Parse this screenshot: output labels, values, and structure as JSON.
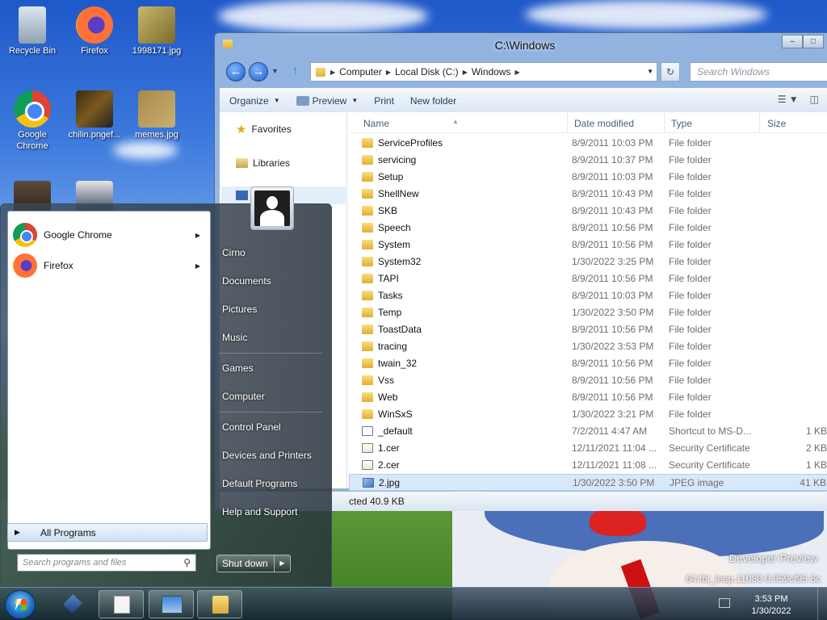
{
  "desktop": {
    "icons": [
      {
        "label": "Recycle Bin"
      },
      {
        "label": "Firefox"
      },
      {
        "label": "1998171.jpg"
      },
      {
        "label": "Google Chrome"
      },
      {
        "label": "chilin.pngef..."
      },
      {
        "label": "memes.jpg"
      }
    ],
    "watermark_line1": "Developer Preview",
    "watermark_line2": "64.fbl_leap.11080",
    "watermark_line3": "0.959cf95",
    "watermark_line4": "6c"
  },
  "explorer": {
    "title": "C:\\Windows",
    "address": [
      "Computer",
      "Local Disk (C:)",
      "Windows"
    ],
    "search_placeholder": "Search Windows",
    "toolbar": {
      "organize": "Organize",
      "preview": "Preview",
      "print": "Print",
      "new_folder": "New folder"
    },
    "nav": {
      "favorites": "Favorites",
      "libraries": "Libraries"
    },
    "columns": {
      "name": "Name",
      "date": "Date modified",
      "type": "Type",
      "size": "Size"
    },
    "rows": [
      {
        "name": "ServiceProfiles",
        "date": "8/9/2011 10:03 PM",
        "type": "File folder",
        "size": "",
        "icon": "folder"
      },
      {
        "name": "servicing",
        "date": "8/9/2011 10:37 PM",
        "type": "File folder",
        "size": "",
        "icon": "folder"
      },
      {
        "name": "Setup",
        "date": "8/9/2011 10:03 PM",
        "type": "File folder",
        "size": "",
        "icon": "folder"
      },
      {
        "name": "ShellNew",
        "date": "8/9/2011 10:43 PM",
        "type": "File folder",
        "size": "",
        "icon": "folder"
      },
      {
        "name": "SKB",
        "date": "8/9/2011 10:43 PM",
        "type": "File folder",
        "size": "",
        "icon": "folder"
      },
      {
        "name": "Speech",
        "date": "8/9/2011 10:56 PM",
        "type": "File folder",
        "size": "",
        "icon": "folder"
      },
      {
        "name": "System",
        "date": "8/9/2011 10:56 PM",
        "type": "File folder",
        "size": "",
        "icon": "folder"
      },
      {
        "name": "System32",
        "date": "1/30/2022 3:25 PM",
        "type": "File folder",
        "size": "",
        "icon": "folder"
      },
      {
        "name": "TAPI",
        "date": "8/9/2011 10:56 PM",
        "type": "File folder",
        "size": "",
        "icon": "folder"
      },
      {
        "name": "Tasks",
        "date": "8/9/2011 10:03 PM",
        "type": "File folder",
        "size": "",
        "icon": "folder"
      },
      {
        "name": "Temp",
        "date": "1/30/2022 3:50 PM",
        "type": "File folder",
        "size": "",
        "icon": "folder"
      },
      {
        "name": "ToastData",
        "date": "8/9/2011 10:56 PM",
        "type": "File folder",
        "size": "",
        "icon": "folder"
      },
      {
        "name": "tracing",
        "date": "1/30/2022 3:53 PM",
        "type": "File folder",
        "size": "",
        "icon": "folder"
      },
      {
        "name": "twain_32",
        "date": "8/9/2011 10:56 PM",
        "type": "File folder",
        "size": "",
        "icon": "folder"
      },
      {
        "name": "Vss",
        "date": "8/9/2011 10:56 PM",
        "type": "File folder",
        "size": "",
        "icon": "folder"
      },
      {
        "name": "Web",
        "date": "8/9/2011 10:56 PM",
        "type": "File folder",
        "size": "",
        "icon": "folder"
      },
      {
        "name": "WinSxS",
        "date": "1/30/2022 3:21 PM",
        "type": "File folder",
        "size": "",
        "icon": "folder"
      },
      {
        "name": "_default",
        "date": "7/2/2011 4:47 AM",
        "type": "Shortcut to MS-D...",
        "size": "1 KB",
        "icon": "shortcut"
      },
      {
        "name": "1.cer",
        "date": "12/11/2021 11:04 ...",
        "type": "Security Certificate",
        "size": "2 KB",
        "icon": "cert"
      },
      {
        "name": "2.cer",
        "date": "12/11/2021 11:08 ...",
        "type": "Security Certificate",
        "size": "1 KB",
        "icon": "cert"
      },
      {
        "name": "2.jpg",
        "date": "1/30/2022 3:50 PM",
        "type": "JPEG image",
        "size": "41 KB",
        "icon": "jpeg",
        "selected": true
      }
    ],
    "status_text": "cted  40.9 KB"
  },
  "start_menu": {
    "programs": [
      {
        "label": "Google Chrome"
      },
      {
        "label": "Firefox"
      }
    ],
    "all_programs": "All Programs",
    "search_placeholder": "Search programs and files",
    "right_items": [
      {
        "label": "Cirno"
      },
      {
        "label": "Documents"
      },
      {
        "label": "Pictures"
      },
      {
        "label": "Music"
      },
      {
        "label": "Games"
      },
      {
        "label": "Computer"
      },
      {
        "label": "Control Panel"
      },
      {
        "label": "Devices and Printers"
      },
      {
        "label": "Default Programs"
      },
      {
        "label": "Help and Support"
      }
    ],
    "shutdown": "Shut down"
  },
  "taskbar": {
    "time": "3:53 PM",
    "date": "1/30/2022"
  }
}
